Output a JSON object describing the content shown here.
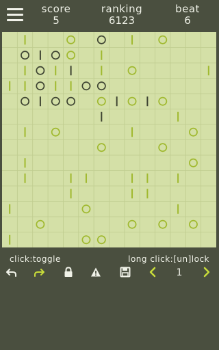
{
  "header": {
    "score_label": "score",
    "score_value": "5",
    "ranking_label": "ranking",
    "ranking_value": "6123",
    "beat_label": "beat",
    "beat_value": "6"
  },
  "board": {
    "rows": 14,
    "cols": 14,
    "pieces": [
      {
        "r": 0,
        "c": 1,
        "k": "bar",
        "dark": false
      },
      {
        "r": 0,
        "c": 4,
        "k": "ring",
        "dark": false
      },
      {
        "r": 0,
        "c": 6,
        "k": "ring",
        "dark": true
      },
      {
        "r": 0,
        "c": 8,
        "k": "bar",
        "dark": false
      },
      {
        "r": 0,
        "c": 10,
        "k": "ring",
        "dark": false
      },
      {
        "r": 1,
        "c": 1,
        "k": "ring",
        "dark": true
      },
      {
        "r": 1,
        "c": 2,
        "k": "bar",
        "dark": true
      },
      {
        "r": 1,
        "c": 3,
        "k": "ring",
        "dark": true
      },
      {
        "r": 1,
        "c": 4,
        "k": "ring",
        "dark": false
      },
      {
        "r": 1,
        "c": 6,
        "k": "bar",
        "dark": false
      },
      {
        "r": 2,
        "c": 1,
        "k": "bar",
        "dark": false
      },
      {
        "r": 2,
        "c": 2,
        "k": "ring",
        "dark": true
      },
      {
        "r": 2,
        "c": 3,
        "k": "bar",
        "dark": false
      },
      {
        "r": 2,
        "c": 4,
        "k": "bar",
        "dark": true
      },
      {
        "r": 2,
        "c": 6,
        "k": "bar",
        "dark": false
      },
      {
        "r": 2,
        "c": 8,
        "k": "ring",
        "dark": false
      },
      {
        "r": 2,
        "c": 13,
        "k": "bar",
        "dark": false
      },
      {
        "r": 3,
        "c": 0,
        "k": "bar",
        "dark": false
      },
      {
        "r": 3,
        "c": 1,
        "k": "bar",
        "dark": false
      },
      {
        "r": 3,
        "c": 2,
        "k": "ring",
        "dark": true
      },
      {
        "r": 3,
        "c": 3,
        "k": "bar",
        "dark": false
      },
      {
        "r": 3,
        "c": 4,
        "k": "bar",
        "dark": false
      },
      {
        "r": 3,
        "c": 5,
        "k": "ring",
        "dark": true
      },
      {
        "r": 3,
        "c": 6,
        "k": "ring",
        "dark": true
      },
      {
        "r": 4,
        "c": 1,
        "k": "ring",
        "dark": true
      },
      {
        "r": 4,
        "c": 2,
        "k": "bar",
        "dark": true
      },
      {
        "r": 4,
        "c": 3,
        "k": "ring",
        "dark": true
      },
      {
        "r": 4,
        "c": 4,
        "k": "ring",
        "dark": true
      },
      {
        "r": 4,
        "c": 6,
        "k": "ring",
        "dark": false
      },
      {
        "r": 4,
        "c": 7,
        "k": "bar",
        "dark": true
      },
      {
        "r": 4,
        "c": 8,
        "k": "ring",
        "dark": false
      },
      {
        "r": 4,
        "c": 9,
        "k": "bar",
        "dark": true
      },
      {
        "r": 4,
        "c": 10,
        "k": "ring",
        "dark": false
      },
      {
        "r": 5,
        "c": 6,
        "k": "bar",
        "dark": true
      },
      {
        "r": 5,
        "c": 11,
        "k": "bar",
        "dark": false
      },
      {
        "r": 6,
        "c": 1,
        "k": "bar",
        "dark": false
      },
      {
        "r": 6,
        "c": 3,
        "k": "ring",
        "dark": false
      },
      {
        "r": 6,
        "c": 8,
        "k": "bar",
        "dark": false
      },
      {
        "r": 6,
        "c": 12,
        "k": "ring",
        "dark": false
      },
      {
        "r": 7,
        "c": 6,
        "k": "ring",
        "dark": false
      },
      {
        "r": 7,
        "c": 10,
        "k": "ring",
        "dark": false
      },
      {
        "r": 8,
        "c": 1,
        "k": "bar",
        "dark": false
      },
      {
        "r": 8,
        "c": 12,
        "k": "ring",
        "dark": false
      },
      {
        "r": 9,
        "c": 1,
        "k": "bar",
        "dark": false
      },
      {
        "r": 9,
        "c": 4,
        "k": "bar",
        "dark": false
      },
      {
        "r": 9,
        "c": 5,
        "k": "bar",
        "dark": false
      },
      {
        "r": 9,
        "c": 8,
        "k": "bar",
        "dark": false
      },
      {
        "r": 9,
        "c": 9,
        "k": "bar",
        "dark": false
      },
      {
        "r": 9,
        "c": 11,
        "k": "bar",
        "dark": false
      },
      {
        "r": 10,
        "c": 4,
        "k": "bar",
        "dark": false
      },
      {
        "r": 10,
        "c": 8,
        "k": "bar",
        "dark": false
      },
      {
        "r": 10,
        "c": 9,
        "k": "bar",
        "dark": false
      },
      {
        "r": 11,
        "c": 0,
        "k": "bar",
        "dark": false
      },
      {
        "r": 11,
        "c": 5,
        "k": "ring",
        "dark": false
      },
      {
        "r": 11,
        "c": 11,
        "k": "bar",
        "dark": false
      },
      {
        "r": 12,
        "c": 2,
        "k": "ring",
        "dark": false
      },
      {
        "r": 12,
        "c": 8,
        "k": "ring",
        "dark": false
      },
      {
        "r": 12,
        "c": 10,
        "k": "ring",
        "dark": false
      },
      {
        "r": 12,
        "c": 12,
        "k": "ring",
        "dark": false
      },
      {
        "r": 13,
        "c": 0,
        "k": "bar",
        "dark": false
      },
      {
        "r": 13,
        "c": 5,
        "k": "ring",
        "dark": false
      },
      {
        "r": 13,
        "c": 6,
        "k": "ring",
        "dark": false
      }
    ]
  },
  "hint": {
    "left": "click:toggle",
    "right": "long  click:[un]lock"
  },
  "toolbar": {
    "level": "1",
    "icons": [
      "undo-icon",
      "redo-icon",
      "lock-icon",
      "warning-icon",
      "save-icon",
      "prev-arrow-icon",
      "next-arrow-icon"
    ]
  },
  "colors": {
    "background": "#4a4f3f",
    "board": "#d4e0a7",
    "grid": "#bfcc8f",
    "piece_light": "#a0b92f",
    "piece_dark": "#3e4432",
    "text": "#f0f2e8",
    "accent": "#c8dc3a"
  }
}
